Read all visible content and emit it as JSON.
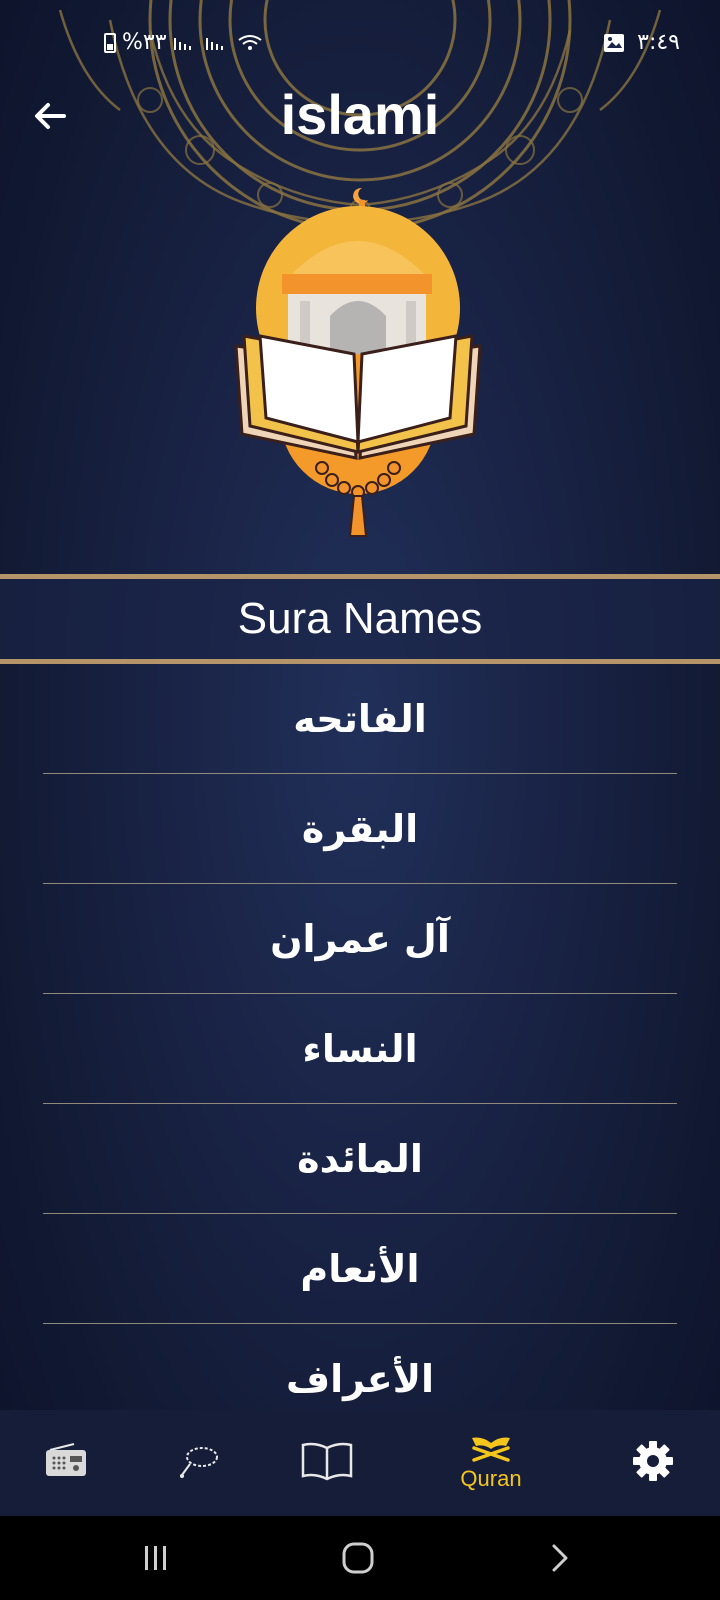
{
  "status_bar": {
    "battery_text": "%٣٣",
    "time": "٣:٤٩"
  },
  "header": {
    "title": "islami"
  },
  "sura_section": {
    "title": "Sura Names",
    "items": [
      {
        "name": "الفاتحه"
      },
      {
        "name": "البقرة"
      },
      {
        "name": "آل عمران"
      },
      {
        "name": "النساء"
      },
      {
        "name": "المائدة"
      },
      {
        "name": "الأنعام"
      },
      {
        "name": "الأعراف"
      }
    ]
  },
  "bottom_nav": {
    "items": [
      {
        "icon": "radio-icon",
        "label": ""
      },
      {
        "icon": "sebha-icon",
        "label": ""
      },
      {
        "icon": "book-icon",
        "label": ""
      },
      {
        "icon": "quran-icon",
        "label": "Quran",
        "active": true
      },
      {
        "icon": "gear-icon",
        "label": ""
      }
    ]
  },
  "colors": {
    "background": "#1a2447",
    "accent_line": "#b6946a",
    "active_nav": "#f4c61c",
    "divider": "#8f8a7d"
  }
}
